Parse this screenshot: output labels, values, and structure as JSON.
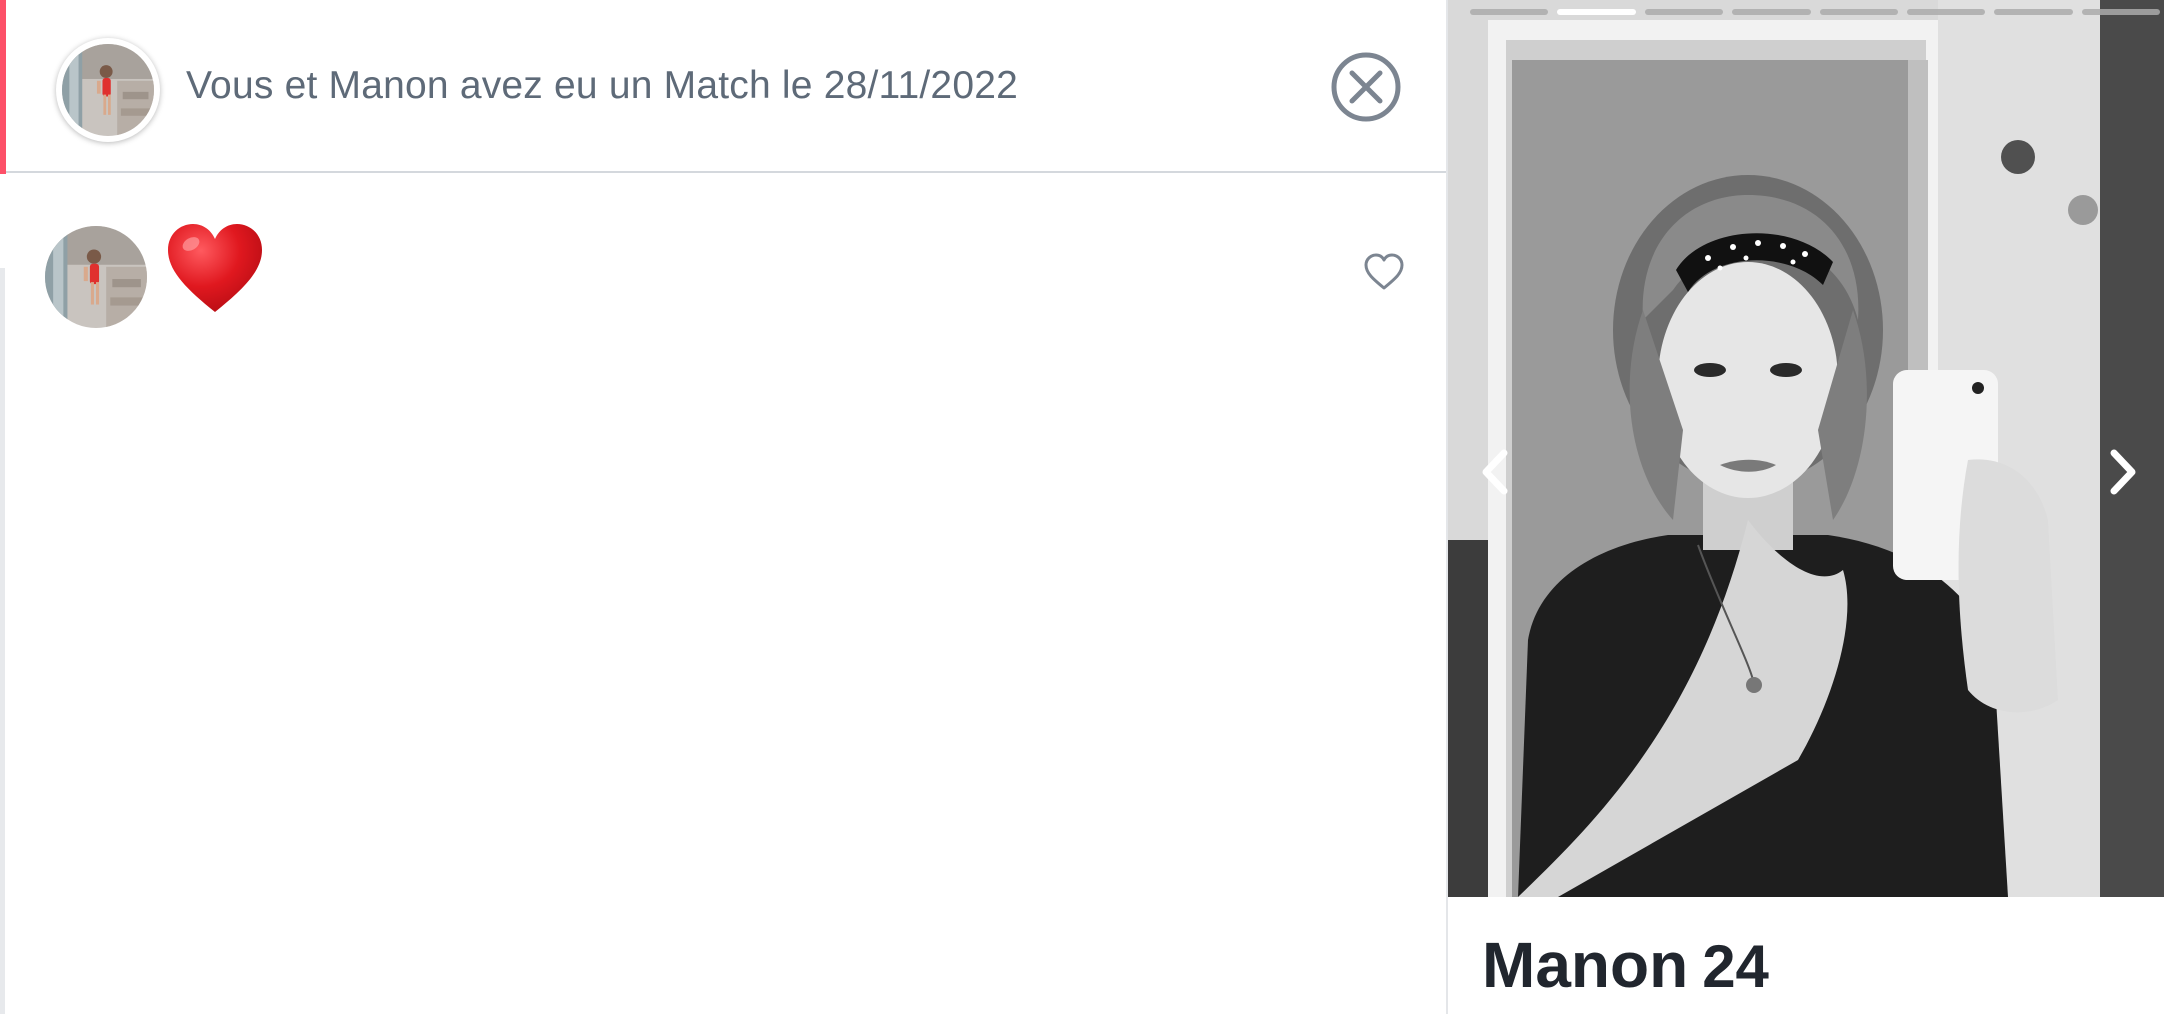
{
  "colors": {
    "accent": "#fd5068",
    "muted_text": "#5e6a78",
    "icon_gray": "#7c8591",
    "name_text": "#21262e",
    "heart_red": "#e0181f"
  },
  "match_header": {
    "text": "Vous et Manon avez eu un Match le 28/11/2022",
    "close_icon": "close-circle-icon"
  },
  "messages": [
    {
      "content_icon": "red-heart-emoji",
      "like_icon": "heart-outline-icon"
    }
  ],
  "profile": {
    "name": "Manon",
    "age": "24",
    "photo_count": 8,
    "active_photo": 2,
    "prev_icon": "chevron-left-icon",
    "next_icon": "chevron-right-icon"
  }
}
